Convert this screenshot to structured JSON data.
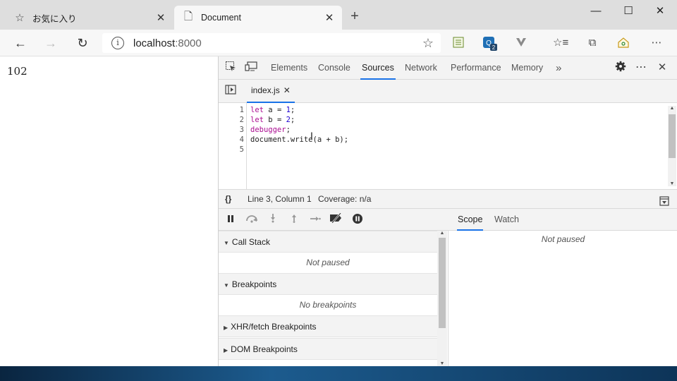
{
  "browser": {
    "tabs": [
      {
        "title": "お気に入り",
        "icon": "star-outline-icon"
      },
      {
        "title": "Document",
        "icon": "page-icon"
      }
    ],
    "new_tab_symbol": "+",
    "window_controls": {
      "minimize": "—",
      "maximize": "☐",
      "close": "✕"
    },
    "address": {
      "host": "localhost",
      "port": ":8000"
    }
  },
  "page": {
    "content": "102"
  },
  "devtools": {
    "tabs": [
      "Elements",
      "Console",
      "Sources",
      "Network",
      "Performance",
      "Memory"
    ],
    "active_tab": "Sources",
    "more_tabs": "»",
    "open_file": "index.js",
    "code": [
      {
        "ln": "1",
        "parts": [
          {
            "t": "let ",
            "c": "kw"
          },
          {
            "t": "a = ",
            "c": "fn"
          },
          {
            "t": "1",
            "c": "num"
          },
          {
            "t": ";",
            "c": "fn"
          }
        ]
      },
      {
        "ln": "2",
        "parts": [
          {
            "t": "let ",
            "c": "kw"
          },
          {
            "t": "b = ",
            "c": "fn"
          },
          {
            "t": "2",
            "c": "num"
          },
          {
            "t": ";",
            "c": "fn"
          }
        ]
      },
      {
        "ln": "3",
        "parts": [
          {
            "t": "debugger",
            "c": "kw"
          },
          {
            "t": ";",
            "c": "fn"
          }
        ]
      },
      {
        "ln": "4",
        "parts": [
          {
            "t": "document.write(a + b);",
            "c": "fn"
          }
        ]
      },
      {
        "ln": "5",
        "parts": []
      }
    ],
    "status": {
      "format_symbol": "{}",
      "position": "Line 3, Column 1",
      "coverage": "Coverage: n/a"
    },
    "sections": {
      "call_stack": {
        "title": "Call Stack",
        "body": "Not paused"
      },
      "breakpoints": {
        "title": "Breakpoints",
        "body": "No breakpoints"
      },
      "xhr": {
        "title": "XHR/fetch Breakpoints"
      },
      "dom": {
        "title": "DOM Breakpoints"
      }
    },
    "scope_tabs": [
      "Scope",
      "Watch"
    ],
    "scope_body": "Not paused"
  },
  "colors": {
    "accent": "#1a73e8",
    "keyword": "#aa0d91",
    "number": "#1c00cf"
  }
}
